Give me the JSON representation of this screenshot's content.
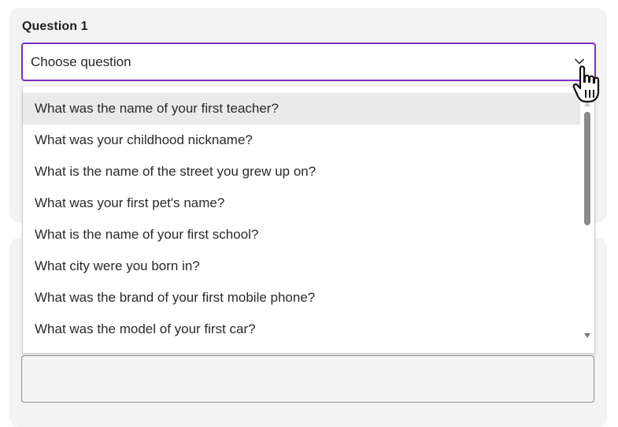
{
  "question": {
    "label": "Question 1",
    "select_value": "Choose question",
    "options": [
      "What was the name of your first teacher?",
      "What was your childhood nickname?",
      "What is the name of the street you grew up on?",
      "What was your first pet's name?",
      "What is the name of your first school?",
      "What city were you born in?",
      "What was the brand of your first mobile phone?",
      "What was the model of your first car?"
    ],
    "highlighted_option_index": 0
  },
  "answer": {
    "value": ""
  },
  "colors": {
    "focus_border": "#7a2fc4",
    "card_background": "#f3f3f4",
    "highlight_background": "#eaeaea",
    "scroll_thumb": "#8a8a8a"
  },
  "icons": {
    "select_chevron": "chevron-down-icon",
    "pointer": "hand-pointer-cursor-icon",
    "scroll_up": "scroll-up-arrow-icon",
    "scroll_down": "scroll-down-arrow-icon"
  }
}
